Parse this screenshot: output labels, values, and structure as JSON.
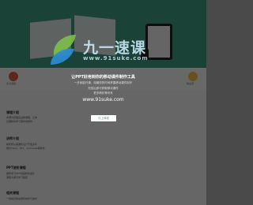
{
  "hero": {
    "alt": ""
  },
  "icons": {
    "left_label": "读书课程",
    "right_label": "精品课"
  },
  "sections": [
    {
      "title": "课程介绍",
      "lines": [
        "本课为原理实战类课程，让你",
        "掌握移动学习课件的制作"
      ]
    },
    {
      "title": "讲师介绍",
      "lines": [
        "胡老师从事课件设计开发多年",
        "擅长Flash、PPT、Articulate等软件"
      ]
    },
    {
      "title": "PPT进阶课程",
      "lines": [
        "推荐学习PPT动画制作进阶",
        "课程大纲与学习路径"
      ]
    },
    {
      "title": "相关课程",
      "lines": [
        "一键搞定移动课件制作与发布"
      ]
    }
  ],
  "logo": {
    "name": "九一速课",
    "url": "www.91suke.com"
  },
  "modal": {
    "title": "让PPT好用到你的移动课件制作工具",
    "subtitle": "一步就能开通，用最短的时间掌握移动课件制作",
    "line2": "完成后即可获取移动课件",
    "line3": "更多精彩等你来",
    "url": "www.91suke.com",
    "cta_label": "马上体验"
  },
  "colors": {
    "accent": "#3f9d83",
    "overlay": "rgba(0,0,0,0.58)"
  }
}
